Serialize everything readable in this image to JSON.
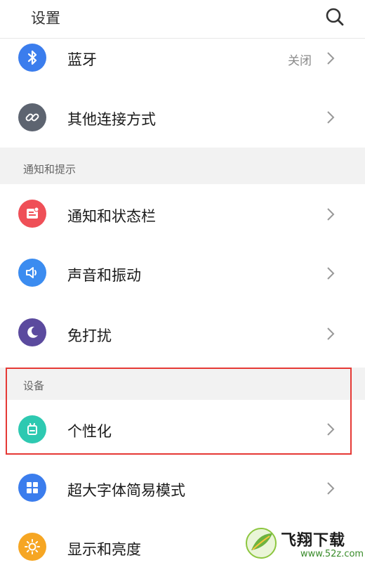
{
  "header": {
    "title": "设置",
    "search_icon": "search-icon"
  },
  "rows": {
    "bluetooth": {
      "label": "蓝牙",
      "value": "关闭",
      "icon": "bluetooth-icon",
      "color": "#3b7ded"
    },
    "other_connections": {
      "label": "其他连接方式",
      "icon": "link-icon",
      "color": "#5d6470"
    },
    "notifications": {
      "label": "通知和状态栏",
      "icon": "notification-icon",
      "color": "#ef4f57"
    },
    "sound": {
      "label": "声音和振动",
      "icon": "speaker-icon",
      "color": "#3b8cf0"
    },
    "dnd": {
      "label": "免打扰",
      "icon": "moon-icon",
      "color": "#5b4a9e"
    },
    "personalize": {
      "label": "个性化",
      "icon": "personalize-icon",
      "color": "#2ec9b1"
    },
    "large_font": {
      "label": "超大字体简易模式",
      "icon": "grid-icon",
      "color": "#3b7ded"
    },
    "display": {
      "label": "显示和亮度",
      "icon": "sun-icon",
      "color": "#f6a623"
    }
  },
  "sections": {
    "notify": {
      "label": "通知和提示"
    },
    "device": {
      "label": "设备"
    }
  },
  "highlight_color": "#e53935",
  "watermark": {
    "brand": "飞翔下载",
    "url": "www.52z.com"
  }
}
